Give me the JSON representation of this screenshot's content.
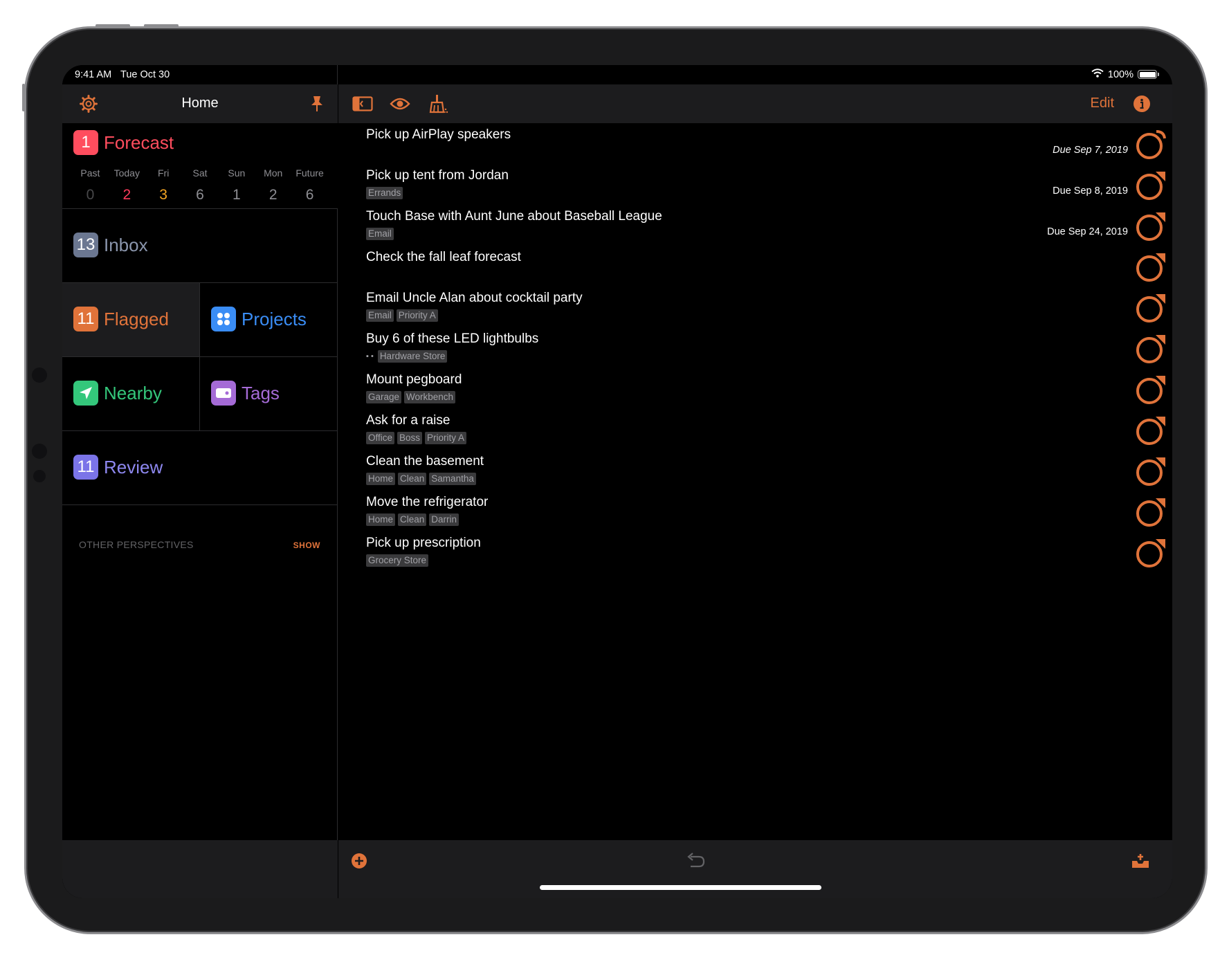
{
  "status_bar": {
    "time": "9:41 AM",
    "date": "Tue Oct 30",
    "battery_text": "100%",
    "battery_level": 1.0
  },
  "sidebar": {
    "title": "Home",
    "forecast": {
      "count": "1",
      "label": "Forecast",
      "days": [
        {
          "name": "Past",
          "count": "0",
          "color": "#48484a"
        },
        {
          "name": "Today",
          "count": "2",
          "color": "#ff3b5c"
        },
        {
          "name": "Fri",
          "count": "3",
          "color": "#f5a623"
        },
        {
          "name": "Sat",
          "count": "6",
          "color": "#8e8e93"
        },
        {
          "name": "Sun",
          "count": "1",
          "color": "#8e8e93"
        },
        {
          "name": "Mon",
          "count": "2",
          "color": "#8e8e93"
        },
        {
          "name": "Future",
          "count": "6",
          "color": "#8e8e93"
        }
      ]
    },
    "inbox": {
      "count": "13",
      "label": "Inbox"
    },
    "flagged": {
      "count": "11",
      "label": "Flagged"
    },
    "projects": {
      "label": "Projects"
    },
    "nearby": {
      "label": "Nearby"
    },
    "tags": {
      "label": "Tags"
    },
    "review": {
      "count": "11",
      "label": "Review"
    },
    "other_perspectives": "OTHER PERSPECTIVES",
    "show_label": "SHOW"
  },
  "main": {
    "edit_label": "Edit",
    "tasks": [
      {
        "title": "Pick up AirPlay speakers",
        "tags": [],
        "due": "Due Sep 7, 2019",
        "due_italic": true,
        "flagged": false
      },
      {
        "title": "Pick up tent from Jordan",
        "tags": [
          "Errands"
        ],
        "due": "Due Sep 8, 2019",
        "due_italic": false,
        "flagged": true
      },
      {
        "title": "Touch Base with Aunt June about Baseball League",
        "tags": [
          "Email"
        ],
        "due": "Due Sep 24, 2019",
        "due_italic": false,
        "flagged": true
      },
      {
        "title": "Check the fall leaf forecast",
        "tags": [],
        "due": "",
        "due_italic": false,
        "flagged": true
      },
      {
        "title": "Email Uncle Alan about cocktail party",
        "tags": [
          "Email",
          "Priority A"
        ],
        "due": "",
        "due_italic": false,
        "flagged": true
      },
      {
        "title": "Buy 6 of these LED lightbulbs",
        "tags": [
          "Hardware Store"
        ],
        "bullet": "▪ •",
        "due": "",
        "due_italic": false,
        "flagged": true
      },
      {
        "title": "Mount pegboard",
        "tags": [
          "Garage",
          "Workbench"
        ],
        "due": "",
        "due_italic": false,
        "flagged": true
      },
      {
        "title": "Ask for a raise",
        "tags": [
          "Office",
          "Boss",
          "Priority A"
        ],
        "due": "",
        "due_italic": false,
        "flagged": true
      },
      {
        "title": "Clean the basement",
        "tags": [
          "Home",
          "Clean",
          "Samantha"
        ],
        "due": "",
        "due_italic": false,
        "flagged": true
      },
      {
        "title": "Move the refrigerator",
        "tags": [
          "Home",
          "Clean",
          "Darrin"
        ],
        "due": "",
        "due_italic": false,
        "flagged": true
      },
      {
        "title": "Pick up prescription",
        "tags": [
          "Grocery Store"
        ],
        "due": "",
        "due_italic": false,
        "flagged": true
      }
    ]
  },
  "colors": {
    "accent": "#e0733a",
    "forecast": "#ff4d5e",
    "inbox": "#6b7791",
    "flagged": "#e0733a",
    "projects": "#3a8df5",
    "nearby": "#34c77b",
    "tags": "#a56bd6",
    "review": "#7b74e8"
  }
}
